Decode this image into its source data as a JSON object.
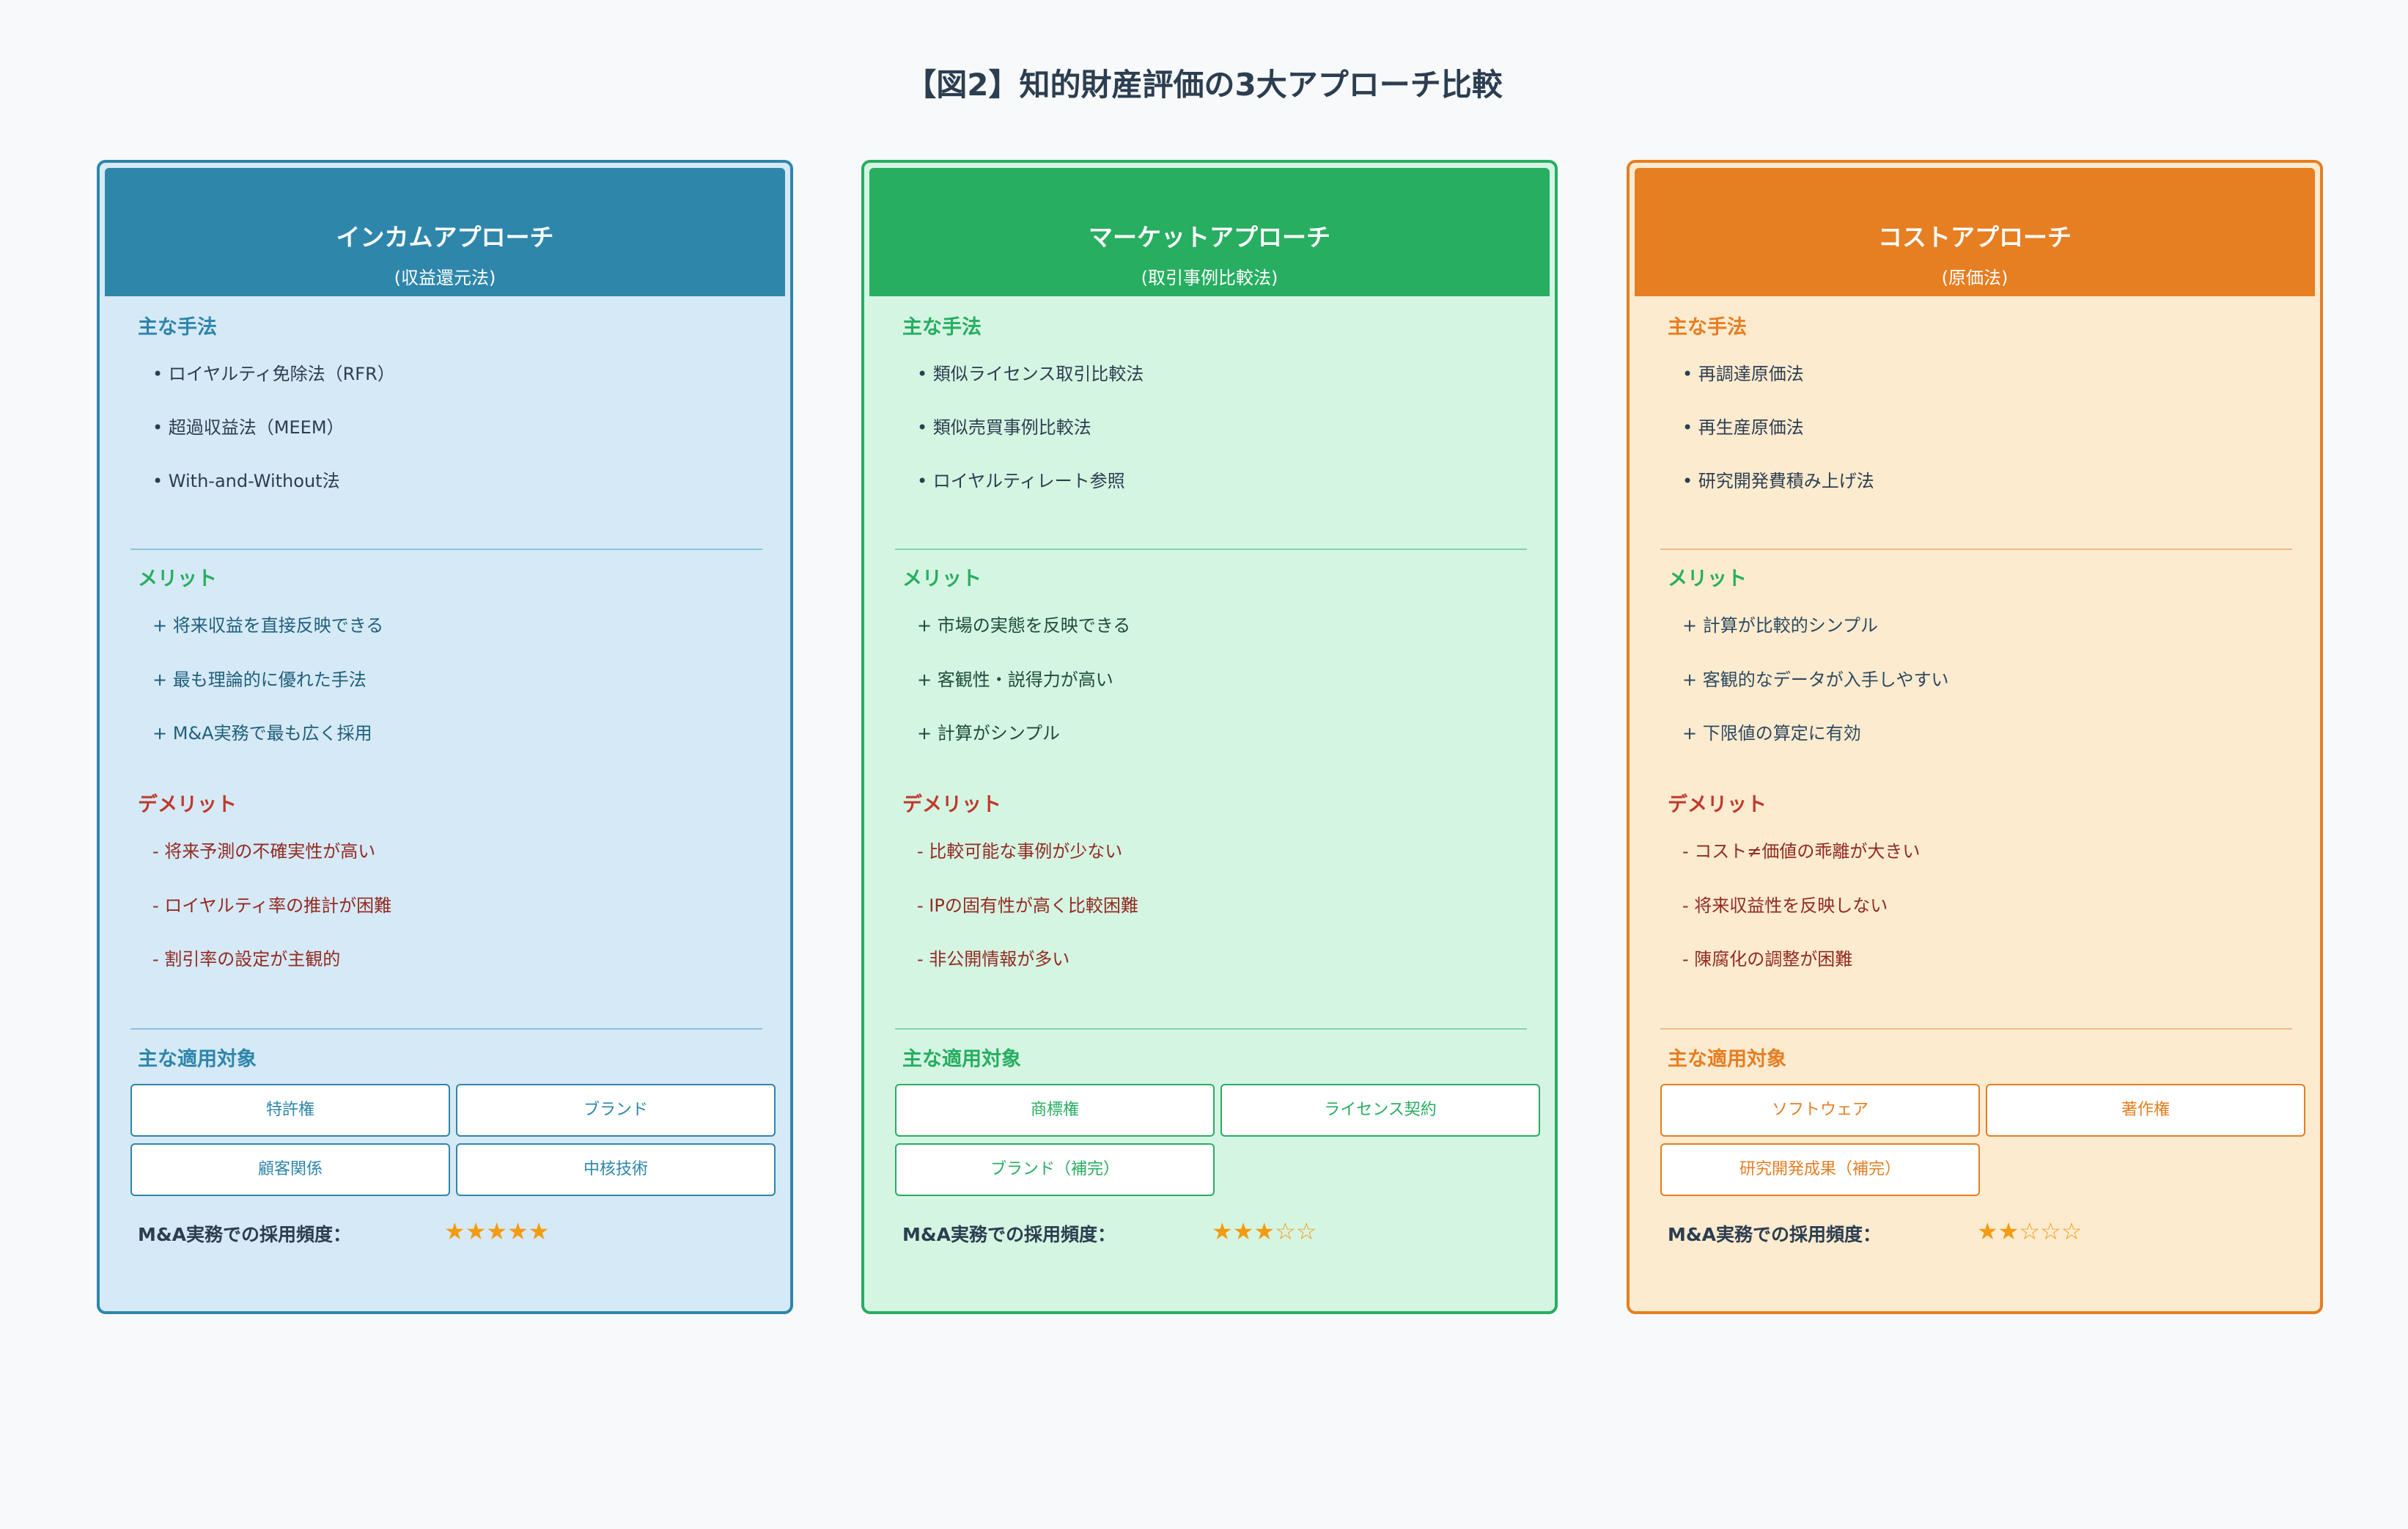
{
  "title": "【図2】知的財産評価の3大アプローチ比較",
  "section_labels": {
    "methods": "主な手法",
    "merits": "メリット",
    "demerits": "デメリット",
    "targets": "主な適用対象",
    "frequency": "M&A実務での採用頻度："
  },
  "cards": [
    {
      "title": "インカムアプローチ",
      "subtitle": "(収益還元法)",
      "methods": [
        "• ロイヤルティ免除法（RFR）",
        "• 超過収益法（MEEM）",
        "• With-and-Without法"
      ],
      "merits": [
        "+ 将来収益を直接反映できる",
        "+ 最も理論的に優れた手法",
        "+ M&A実務で最も広く採用"
      ],
      "demerits": [
        "- 将来予測の不確実性が高い",
        "- ロイヤルティ率の推計が困難",
        "- 割引率の設定が主観的"
      ],
      "targets": [
        "特許権",
        "ブランド",
        "顧客関係",
        "中核技術"
      ],
      "stars": "★★★★★",
      "rating": 5,
      "color": "#2e86ab"
    },
    {
      "title": "マーケットアプローチ",
      "subtitle": "(取引事例比較法)",
      "methods": [
        "• 類似ライセンス取引比較法",
        "• 類似売買事例比較法",
        "• ロイヤルティレート参照"
      ],
      "merits": [
        "+ 市場の実態を反映できる",
        "+ 客観性・説得力が高い",
        "+ 計算がシンプル"
      ],
      "demerits": [
        "- 比較可能な事例が少ない",
        "- IPの固有性が高く比較困難",
        "- 非公開情報が多い"
      ],
      "targets": [
        "商標権",
        "ライセンス契約",
        "ブランド（補完）"
      ],
      "stars": "★★★☆☆",
      "rating": 3,
      "color": "#27ae60"
    },
    {
      "title": "コストアプローチ",
      "subtitle": "(原価法)",
      "methods": [
        "• 再調達原価法",
        "• 再生産原価法",
        "• 研究開発費積み上げ法"
      ],
      "merits": [
        "+ 計算が比較的シンプル",
        "+ 客観的なデータが入手しやすい",
        "+ 下限値の算定に有効"
      ],
      "demerits": [
        "- コスト≠価値の乖離が大きい",
        "- 将来収益性を反映しない",
        "- 陳腐化の調整が困難"
      ],
      "targets": [
        "ソフトウェア",
        "著作権",
        "研究開発成果（補完）"
      ],
      "stars": "★★☆☆☆",
      "rating": 2,
      "color": "#e67e22"
    }
  ]
}
